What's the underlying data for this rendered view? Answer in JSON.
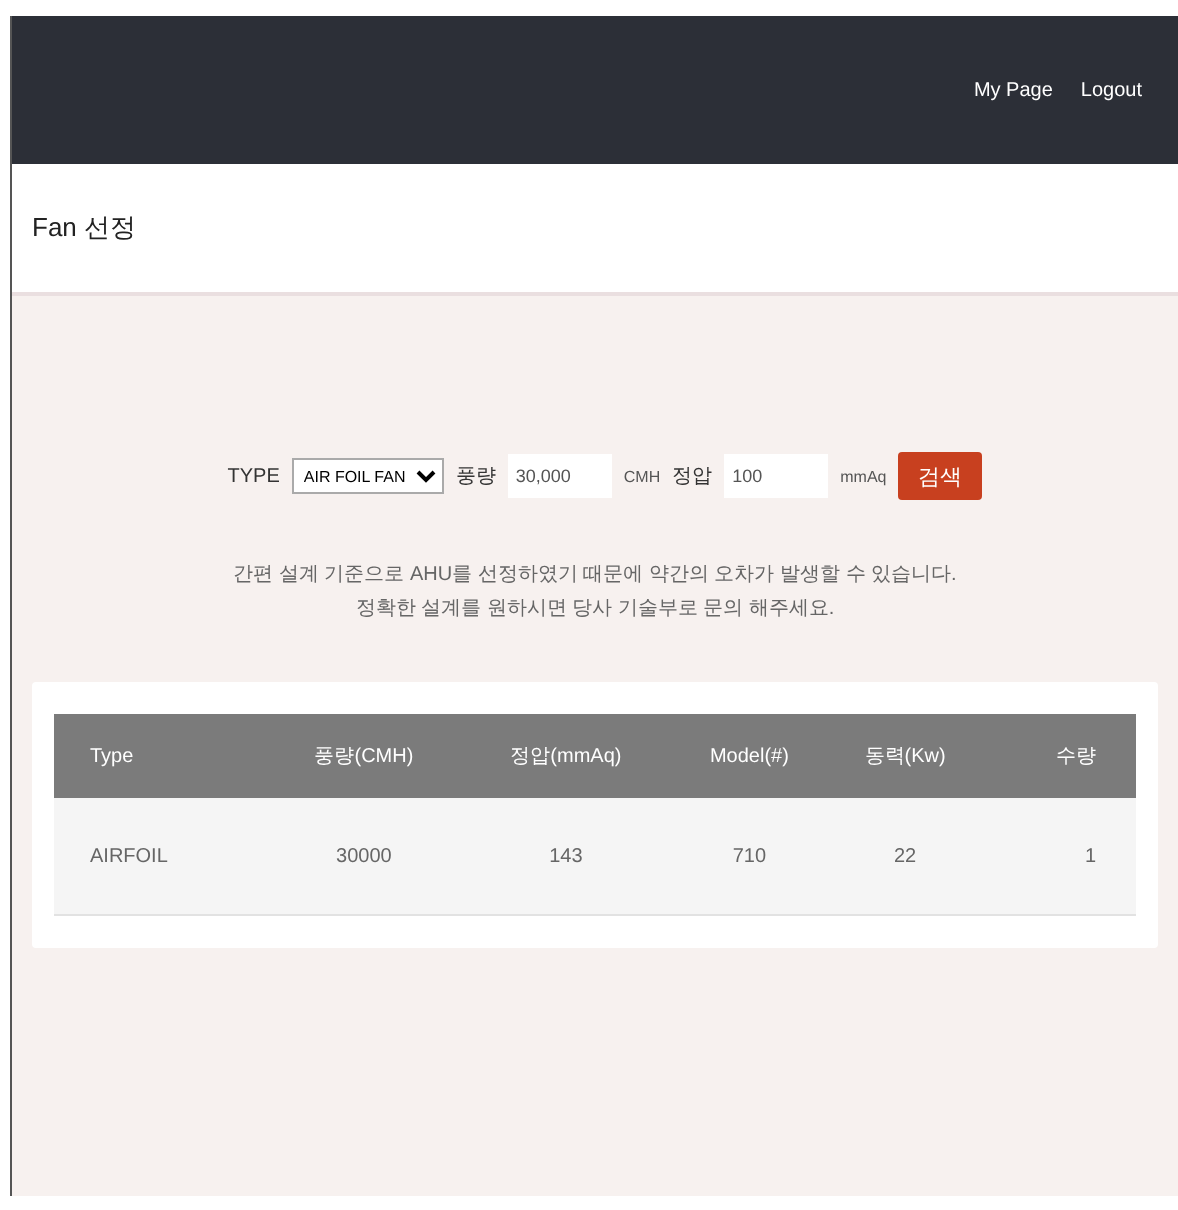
{
  "nav": {
    "links": [
      "My Page",
      "Logout"
    ]
  },
  "page_title": "Fan 선정",
  "form": {
    "type_label": "TYPE",
    "type_value": "AIR FOIL FAN",
    "flow_label": "풍량",
    "flow_value": "30,000",
    "flow_unit": "CMH",
    "pressure_label": "정압",
    "pressure_value": "100",
    "pressure_unit": "mmAq",
    "search_button": "검색"
  },
  "notice": [
    "간편 설계 기준으로 AHU를 선정하였기 때문에 약간의 오차가 발생할 수 있습니다.",
    "정확한 설계를 원하시면 당사 기술부로 문의 해주세요."
  ],
  "table": {
    "columns": [
      "Type",
      "풍량(CMH)",
      "정압(mmAq)",
      "Model(#)",
      "동력(Kw)",
      "수량"
    ],
    "rows": [
      [
        "AIRFOIL",
        "30000",
        "143",
        "710",
        "22",
        "1"
      ]
    ]
  }
}
